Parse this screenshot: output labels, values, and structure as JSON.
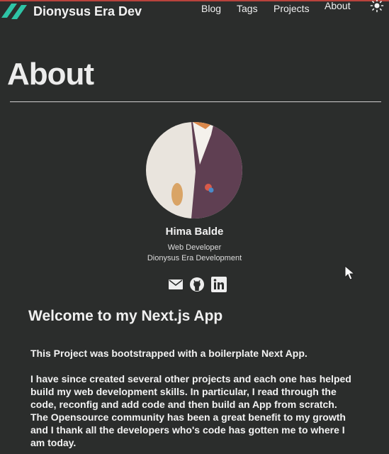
{
  "colors": {
    "background": "#2b2d2c",
    "accent": "#2ec4a6",
    "top_border": "#b8433c"
  },
  "header": {
    "brand": "Dionysus Era Dev",
    "nav": [
      {
        "label": "Blog"
      },
      {
        "label": "Tags"
      },
      {
        "label": "Projects"
      },
      {
        "label": "About"
      }
    ],
    "theme_toggle_icon": "sun-icon"
  },
  "page": {
    "title": "About"
  },
  "profile": {
    "name": "Hima Balde",
    "role": "Web Developer",
    "organization": "Dionysus Era Development",
    "social_icons": [
      "mail-icon",
      "github-icon",
      "linkedin-icon"
    ]
  },
  "content": {
    "heading": "Welcome to my Next.js App",
    "paragraph_1": "This Project was bootstrapped with a boilerplate Next App.",
    "paragraph_2": "I have since created several other projects and each one has helped build my web development skills. In particular, I read through the code, reconfig and add code and then build an App from scratch. The Opensource community has been a great benefit to my growth and I thank all the developers who's code has gotten me to where I am today."
  }
}
